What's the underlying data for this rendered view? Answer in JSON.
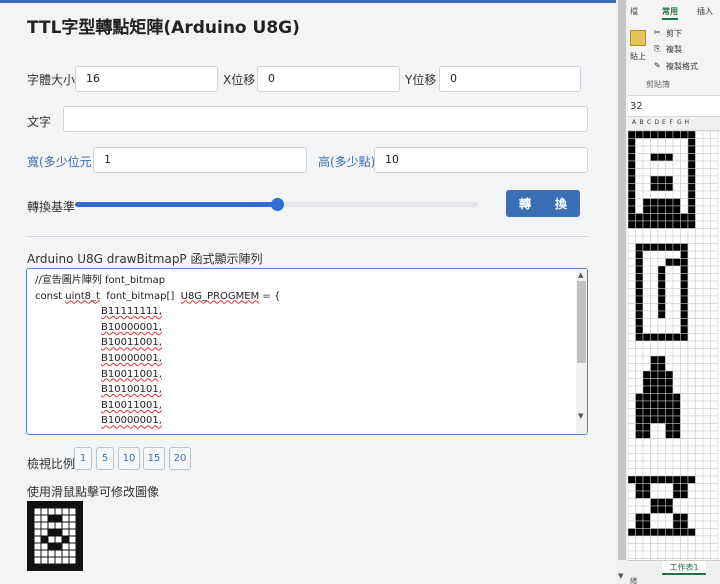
{
  "app": {
    "title": "TTL字型轉點矩陣(Arduino U8G)"
  },
  "form": {
    "font_size_label": "字體大小",
    "font_size_value": "16",
    "x_offset_label": "X位移",
    "x_offset_value": "0",
    "y_offset_label": "Y位移",
    "y_offset_value": "0",
    "text_label": "文字",
    "text_value": "",
    "width_label": "寬(多少位元)",
    "width_value": "1",
    "height_label": "高(多少點)",
    "height_value": "10",
    "threshold_label": "轉換基準",
    "threshold_fraction": 0.5,
    "convert_button": "轉　　換"
  },
  "output": {
    "label": "Arduino U8G drawBitmapP 函式顯示陣列",
    "comment_line": "//宣告圖片陣列 font_bitmap",
    "decl_prefix": "const ",
    "decl_type": "uint8_t",
    "decl_middle": "  font_bitmap[]  ",
    "decl_macro": "U8G_PROGMEM",
    "decl_suffix": " = {",
    "rows": [
      "B11111111,",
      "B10000001,",
      "B10011001,",
      "B10000001,",
      "B10011001,",
      "B10100101,",
      "B10011001,",
      "B10000001,"
    ]
  },
  "zoom": {
    "label": "檢視比例",
    "options": [
      "1",
      "5",
      "10",
      "15",
      "20"
    ]
  },
  "preview": {
    "label": "使用滑鼠點擊可修改圖像",
    "bitmap": [
      "11111111",
      "10000001",
      "10011001",
      "10000001",
      "10011001",
      "10100101",
      "10011001",
      "10000001",
      "10000001",
      "11111111"
    ]
  },
  "excel": {
    "tab_common": "常用",
    "tab_insert": "插入",
    "cut": "剪下",
    "copy": "複製",
    "format_painter": "複製格式",
    "paste": "貼上",
    "clipboard_group": "剪貼簿",
    "cell_value": "32",
    "columns": [
      "A",
      "B",
      "C",
      "D",
      "E",
      "F",
      "G",
      "H"
    ],
    "sheet_tab": "工作表1",
    "status": "緒"
  }
}
